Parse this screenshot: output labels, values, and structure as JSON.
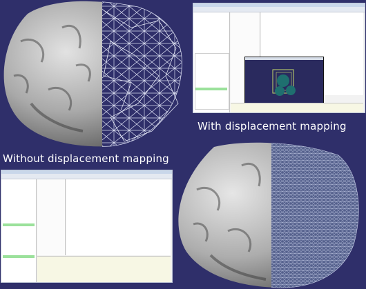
{
  "captions": {
    "with_displacement": "With displacement mapping",
    "without_displacement": "Without displacement mapping"
  },
  "colors": {
    "background": "#2f2f6a",
    "rock_surface": "#b9b9b9",
    "wireframe": "#d8dcf0",
    "editor_bg": "#f2f2f2",
    "highlight": "#9be19b"
  },
  "icons": [
    "rock-shaded-render",
    "wireframe-mesh",
    "editor-screenshot",
    "sphere-preview"
  ]
}
